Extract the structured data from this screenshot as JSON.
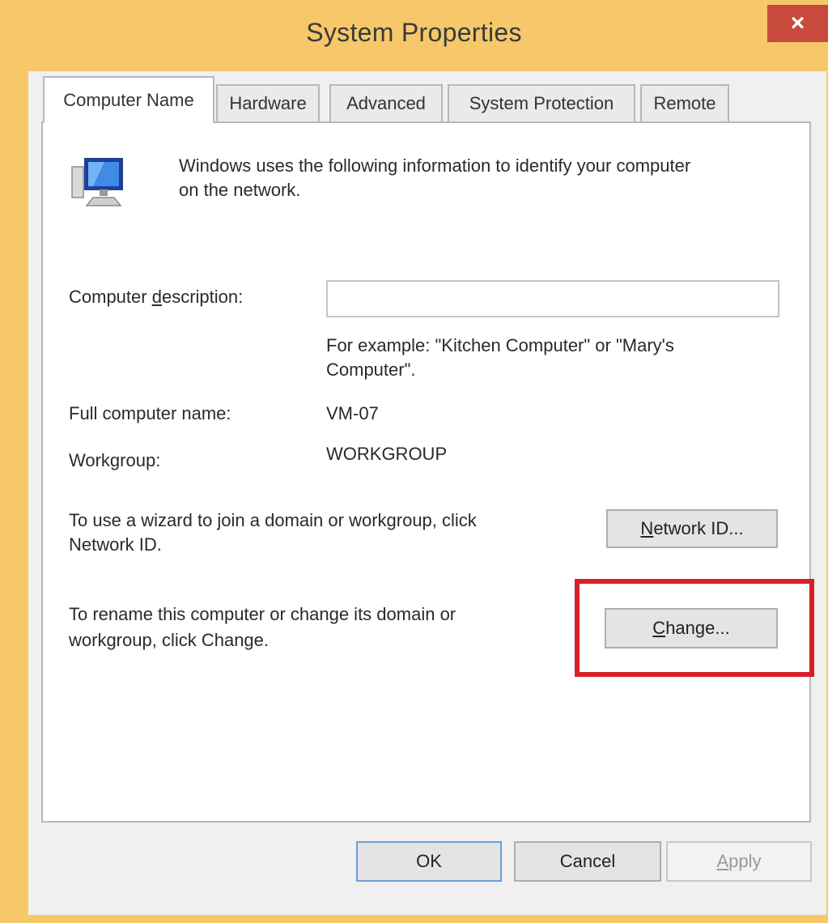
{
  "window": {
    "title": "System Properties",
    "close_glyph": "×"
  },
  "tabs": [
    {
      "label": "Computer Name",
      "active": true
    },
    {
      "label": "Hardware",
      "active": false
    },
    {
      "label": "Advanced",
      "active": false
    },
    {
      "label": "System Protection",
      "active": false
    },
    {
      "label": "Remote",
      "active": false
    }
  ],
  "computer_name_tab": {
    "intro_text_line1": "Windows uses the following information to identify your computer",
    "intro_text_line2": "on the network.",
    "description_label_pre": "Computer ",
    "description_label_u": "d",
    "description_label_post": "escription:",
    "description_value": "",
    "example_line1": "For example: \"Kitchen Computer\" or \"Mary's",
    "example_line2": "Computer\".",
    "full_name_label": "Full computer name:",
    "full_name_value": "VM-07",
    "workgroup_label": "Workgroup:",
    "workgroup_value": "WORKGROUP",
    "network_text_line1": "To use a wizard to join a domain or workgroup, click",
    "network_text_line2": "Network ID.",
    "network_button_u": "N",
    "network_button_rest": "etwork ID...",
    "change_text_line1": "To rename this computer or change its domain or",
    "change_text_line2": "workgroup, click Change.",
    "change_button_u": "C",
    "change_button_rest": "hange..."
  },
  "footer": {
    "ok_label": "OK",
    "cancel_label": "Cancel",
    "apply_u": "A",
    "apply_rest": "pply"
  },
  "icon": "computer-monitor-icon",
  "colors": {
    "title_bar": "#f6c86a",
    "close_button": "#c74a3c",
    "highlight": "#d81f2a"
  }
}
